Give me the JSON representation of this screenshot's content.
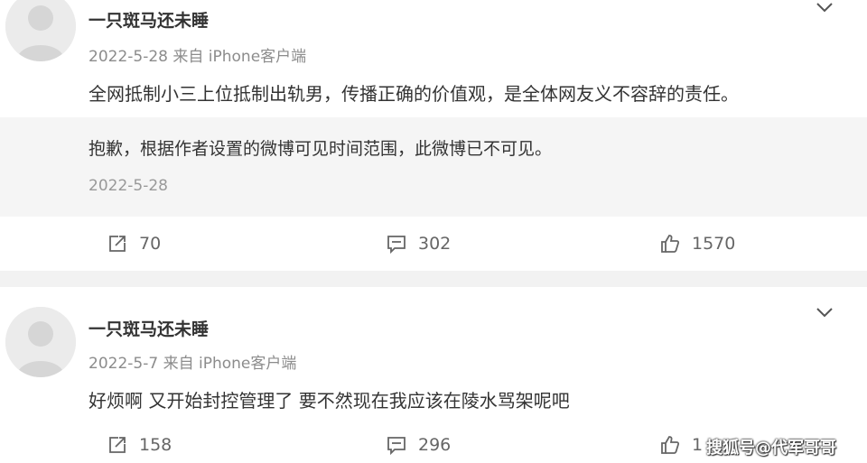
{
  "posts": [
    {
      "username": "一只斑马还未睡",
      "meta": "2022-5-28  来自 iPhone客户端",
      "content": "全网抵制小三上位抵制出轨男，传播正确的价值观，是全体网友义不容辞的责任。",
      "repost": {
        "text": "抱歉，根据作者设置的微博可见时间范围，此微博已不可见。",
        "date": "2022-5-28"
      },
      "actions": {
        "repost_count": "70",
        "comment_count": "302",
        "like_count": "1570"
      }
    },
    {
      "username": "一只斑马还未睡",
      "meta": "2022-5-7  来自 iPhone客户端",
      "content": "好烦啊 又开始封控管理了 要不然现在我应该在陵水骂架呢吧",
      "actions": {
        "repost_count": "158",
        "comment_count": "296",
        "like_count": "1"
      }
    }
  ],
  "watermark": "搜狐号@代军哥哥",
  "icons": {
    "avatar": "default-avatar-icon",
    "menu": "chevron-down-icon",
    "repost": "repost-icon",
    "comment": "comment-icon",
    "like": "thumbs-up-icon"
  },
  "colors": {
    "text": "#333333",
    "meta": "#8c8c8c",
    "repost_bg": "#f5f5f5",
    "separator": "#f2f2f2",
    "icon": "#666666"
  }
}
